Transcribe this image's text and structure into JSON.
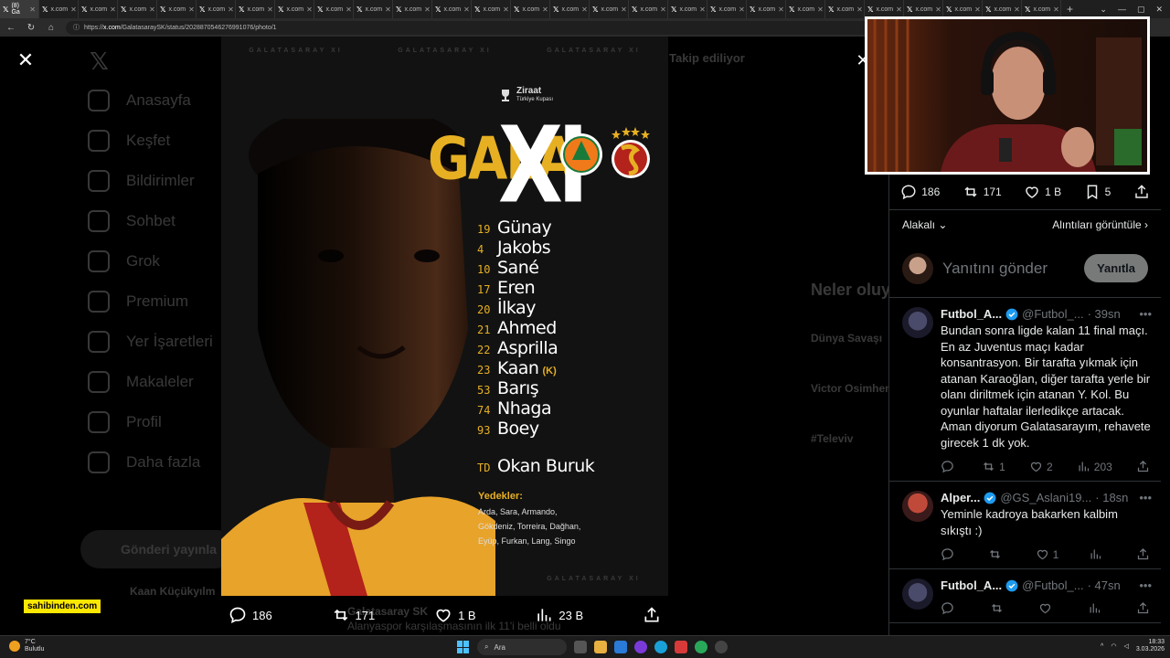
{
  "browser": {
    "tabs": [
      {
        "label": "(8) Ga",
        "active": true
      },
      {
        "label": "x.com"
      },
      {
        "label": "x.com"
      },
      {
        "label": "x.com"
      },
      {
        "label": "x.com"
      },
      {
        "label": "x.com"
      },
      {
        "label": "x.com"
      },
      {
        "label": "x.com"
      },
      {
        "label": "x.com"
      },
      {
        "label": "x.com"
      },
      {
        "label": "x.com"
      },
      {
        "label": "x.com"
      },
      {
        "label": "x.com"
      },
      {
        "label": "x.com"
      },
      {
        "label": "x.com"
      },
      {
        "label": "x.com"
      },
      {
        "label": "x.com"
      },
      {
        "label": "x.com"
      },
      {
        "label": "x.com"
      },
      {
        "label": "x.com"
      },
      {
        "label": "x.com"
      },
      {
        "label": "x.com"
      },
      {
        "label": "x.com"
      },
      {
        "label": "x.com"
      },
      {
        "label": "x.com"
      },
      {
        "label": "x.com"
      },
      {
        "label": "x.com"
      }
    ],
    "url_prefix": "https://",
    "url_host": "x.com",
    "url_path": "/GalatasaraySK/status/2028870546276991076/photo/1"
  },
  "background": {
    "sidebar": [
      "Anasayfa",
      "Keşfet",
      "Bildirimler",
      "Sohbet",
      "Grok",
      "Premium",
      "Yer İşaretleri",
      "Makaleler",
      "Profil",
      "Daha fazla"
    ],
    "post_button": "Gönderi yayınla",
    "following": "Takip ediliyor",
    "trends_title": "Neler oluyor",
    "trends": [
      "Dünya Savaşı",
      "Victor Osimhen",
      "#Televiv"
    ],
    "user_partial": "Kaan Küçükyılm",
    "tweet_partial": "Galatasaray SK",
    "tweet_partial2": "Alanyaspor karşılaşmasının ilk 11'i belli oldu"
  },
  "poster": {
    "watermark": [
      "GALATASARAY XI",
      "GALATASARAY XI",
      "GALATASARAY XI"
    ],
    "cup_line1": "Ziraat",
    "cup_line2": "Türkiye Kupası",
    "gala": "GALA",
    "xi": "XI",
    "lineup": [
      {
        "num": "19",
        "name": "Günay"
      },
      {
        "num": "4",
        "name": "Jakobs"
      },
      {
        "num": "10",
        "name": "Sané"
      },
      {
        "num": "17",
        "name": "Eren"
      },
      {
        "num": "20",
        "name": "İlkay"
      },
      {
        "num": "21",
        "name": "Ahmed"
      },
      {
        "num": "22",
        "name": "Asprilla"
      },
      {
        "num": "23",
        "name": "Kaan",
        "captain": "(K)"
      },
      {
        "num": "53",
        "name": "Barış"
      },
      {
        "num": "74",
        "name": "Nhaga"
      },
      {
        "num": "93",
        "name": "Boey"
      }
    ],
    "coach_num": "TD",
    "coach": "Okan Buruk",
    "subs_title": "Yedekler:",
    "subs": "Arda, Sara, Armando,\nGökdeniz, Torreira, Dağhan,\nEyüp, Furkan, Lang, Singo"
  },
  "media_actions": {
    "replies": "186",
    "reposts": "171",
    "likes": "1 B",
    "views": "23 B"
  },
  "overlay_badge": "sahibinden.com",
  "panel": {
    "replies": "186",
    "reposts": "171",
    "likes": "1 B",
    "bookmarks": "5",
    "sort_label": "Alakalı",
    "quotes_link": "Alıntıları görüntüle",
    "reply_placeholder": "Yanıtını gönder",
    "reply_button": "Yanıtla",
    "tweets": [
      {
        "name": "Futbol_A...",
        "handle": "@Futbol_...",
        "time": "· 39sn",
        "text": "Bundan sonra ligde kalan 11 final maçı. En az Juventus maçı kadar konsantrasyon. Bir tarafta yıkmak için atanan Karaoğlan, diğer tarafta yerle bir olanı diriltmek için atanan Y. Kol. Bu oyunlar haftalar ilerledikçe artacak.\nAman diyorum Galatasarayım, rehavete girecek 1 dk yok.",
        "replies": "",
        "reposts": "1",
        "likes": "2",
        "views": "203"
      },
      {
        "name": "Alper...",
        "handle": "@GS_Aslani19...",
        "time": "· 18sn",
        "text": "Yeminle kadroya bakarken kalbim sıkıştı :)",
        "replies": "",
        "reposts": "",
        "likes": "1",
        "views": ""
      },
      {
        "name": "Futbol_A...",
        "handle": "@Futbol_...",
        "time": "· 47sn",
        "text": "",
        "replies": "",
        "reposts": "",
        "likes": "",
        "views": ""
      }
    ]
  },
  "taskbar": {
    "temp": "7°C",
    "weather": "Bulutlu",
    "search": "Ara",
    "time": "18:33",
    "date": "3.03.2026"
  },
  "colors": {
    "accent_gold": "#e6b022",
    "verified_blue": "#1d9bf0"
  }
}
